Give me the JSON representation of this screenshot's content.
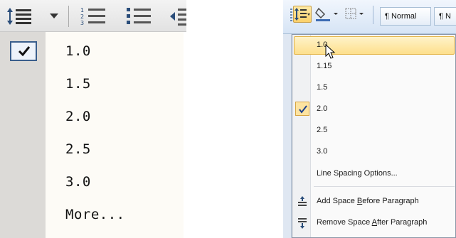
{
  "left_menu": {
    "items": [
      {
        "label": "1.0",
        "checked": true
      },
      {
        "label": "1.5",
        "checked": false
      },
      {
        "label": "2.0",
        "checked": false
      },
      {
        "label": "2.5",
        "checked": false
      },
      {
        "label": "3.0",
        "checked": false
      },
      {
        "label": "More...",
        "checked": false
      }
    ],
    "toolbar_icons": [
      "line-spacing-icon",
      "dropdown-arrow-icon",
      "numbered-list-icon",
      "bullet-list-icon",
      "decrease-indent-icon"
    ]
  },
  "right_toolbar": {
    "style_normal": "¶ Normal",
    "style_partial": "¶ N"
  },
  "right_menu": {
    "items": [
      {
        "label": "1.0",
        "state": "hover"
      },
      {
        "label": "1.15"
      },
      {
        "label": "1.5"
      },
      {
        "label": "2.0",
        "state": "checked"
      },
      {
        "label": "2.5"
      },
      {
        "label": "3.0"
      }
    ],
    "options_label": "Line Spacing Options...",
    "add_space_before": {
      "pre": "Add Space ",
      "key": "B",
      "post": "efore Paragraph"
    },
    "remove_space_after": {
      "pre": "Remove Space ",
      "key": "A",
      "post": "fter Paragraph"
    }
  },
  "colors": {
    "hover_bg": "#fddf8c",
    "check_border": "#3a5e8c",
    "ribbon_bg": "#d6e4f5"
  }
}
